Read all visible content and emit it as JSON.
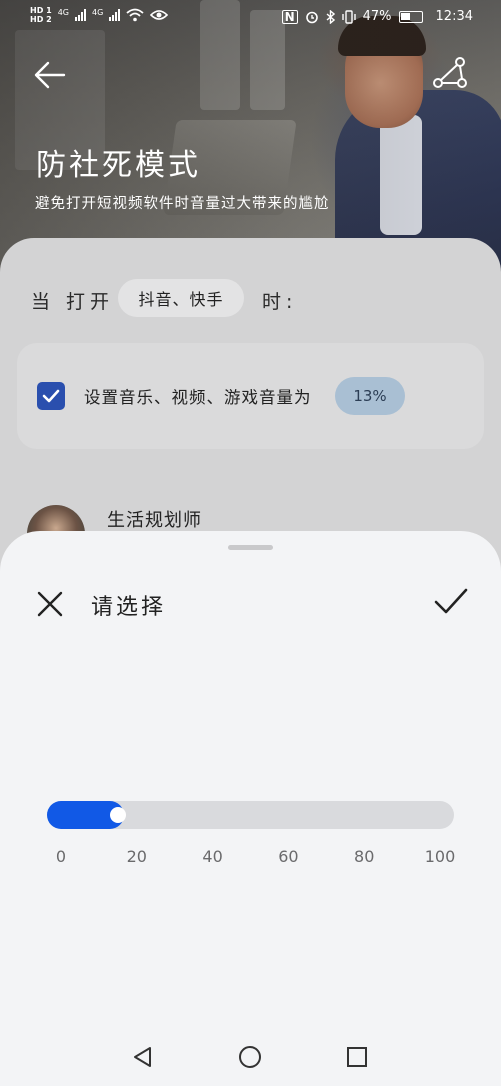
{
  "status_bar": {
    "left": {
      "sim1": "HD 1",
      "sim2": "HD 2",
      "net1": "4G",
      "net2": "4G"
    },
    "right": {
      "nfc": "N",
      "battery_pct": "47%",
      "time": "12:34"
    }
  },
  "header": {
    "title": "防社死模式",
    "subtitle": "避免打开短视频软件时音量过大带来的尴尬"
  },
  "rule": {
    "when_label": "当 打开",
    "apps_chip": "抖音、快手",
    "then_label": "时:",
    "setting_text": "设置音乐、视频、游戏音量为",
    "checked": true,
    "volume_chip": "13%"
  },
  "author": {
    "name": "生活规划师"
  },
  "sheet": {
    "title": "请选择",
    "slider": {
      "min": 0,
      "max": 100,
      "value": 13,
      "ticks": [
        "0",
        "20",
        "40",
        "60",
        "80",
        "100"
      ]
    }
  },
  "colors": {
    "accent": "#1159e6",
    "checkbox": "#2a4fae",
    "chip": "#a9bfd3"
  },
  "icons": {
    "back": "arrow-left-icon",
    "share": "share-icon",
    "close": "close-icon",
    "confirm": "check-icon",
    "nav_back": "triangle-back-icon",
    "nav_home": "circle-home-icon",
    "nav_recent": "square-recent-icon"
  }
}
